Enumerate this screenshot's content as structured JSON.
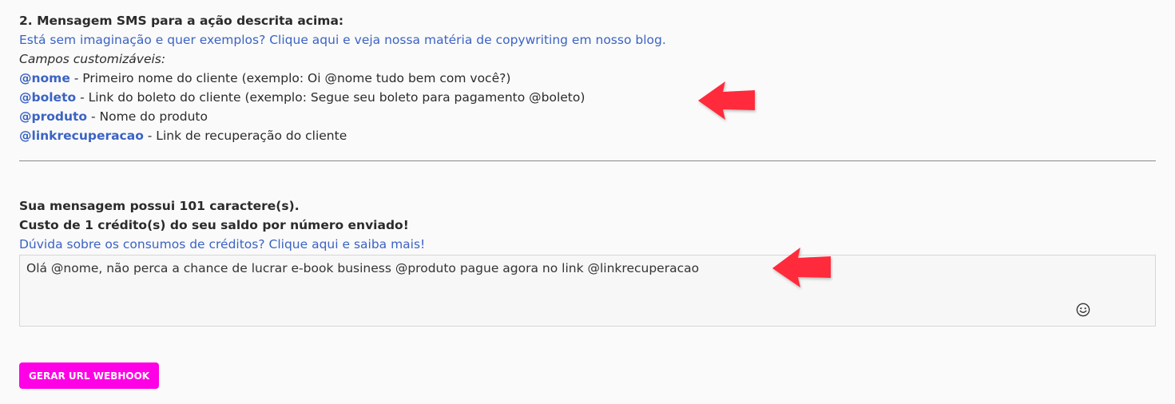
{
  "section": {
    "heading": "2. Mensagem SMS para a ação descrita acima:",
    "copywriting_link": "Está sem imaginação e quer exemplos? Clique aqui e veja nossa matéria de copywriting em nosso blog.",
    "custom_fields_label": "Campos customizáveis:",
    "fields": [
      {
        "name": "@nome",
        "description": " - Primeiro nome do cliente (exemplo: Oi @nome tudo bem com você?)"
      },
      {
        "name": "@boleto",
        "description": " - Link do boleto do cliente (exemplo: Segue seu boleto para pagamento @boleto)"
      },
      {
        "name": "@produto",
        "description": " - Nome do produto"
      },
      {
        "name": "@linkrecuperacao",
        "description": " - Link de recuperação do cliente"
      }
    ]
  },
  "message": {
    "char_count_text": "Sua mensagem possui 101 caractere(s).",
    "cost_text": "Custo de 1 crédito(s) do seu saldo por número enviado!",
    "credits_help_link": "Dúvida sobre os consumos de créditos? Clique aqui e saiba mais!",
    "value": "Olá @nome, não perca a chance de lucrar e-book business @produto pague agora no link @linkrecuperacao"
  },
  "actions": {
    "webhook_button_label": "GERAR URL WEBHOOK"
  },
  "colors": {
    "link": "#3b63c4",
    "accent_button": "#ff00e6",
    "arrow": "#ff2a3a"
  },
  "icons": {
    "emoji": "smiley-icon",
    "annotation": "arrow-left-icon"
  }
}
